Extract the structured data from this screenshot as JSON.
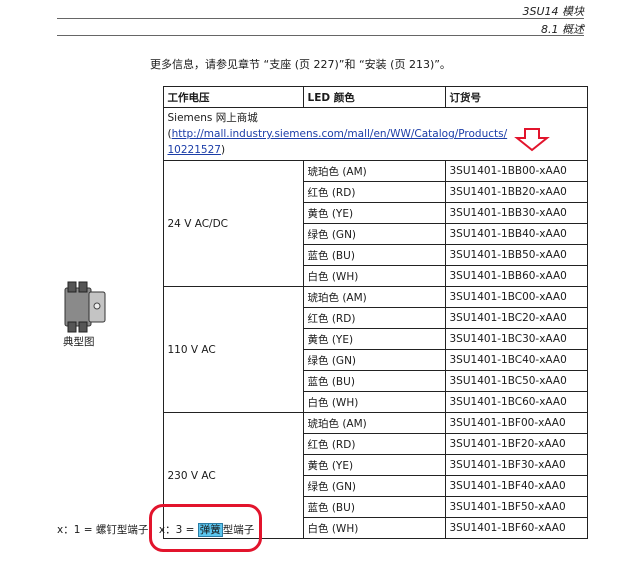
{
  "header": {
    "chapter": "3SU14 模块",
    "section": "8.1 概述"
  },
  "intro": "更多信息，请参见章节 “支座 (页 227)”和 “安装 (页 213)”。",
  "table": {
    "image_caption": "典型图",
    "columns": [
      "工作电压",
      "LED 颜色",
      "订货号"
    ],
    "mall": {
      "prefix": "Siemens 网上商城 (",
      "link_line1": "http://mall.industry.siemens.com/mall/en/WW/Catalog/Products/",
      "link_line2": "10221527",
      "suffix": ")"
    },
    "groups": [
      {
        "voltage": "24 V AC/DC",
        "rows": [
          {
            "color": "琥珀色 (AM)",
            "order": "3SU1401-1BB00-xAA0"
          },
          {
            "color": "红色 (RD)",
            "order": "3SU1401-1BB20-xAA0"
          },
          {
            "color": "黄色 (YE)",
            "order": "3SU1401-1BB30-xAA0"
          },
          {
            "color": "绿色 (GN)",
            "order": "3SU1401-1BB40-xAA0"
          },
          {
            "color": "蓝色 (BU)",
            "order": "3SU1401-1BB50-xAA0"
          },
          {
            "color": "白色 (WH)",
            "order": "3SU1401-1BB60-xAA0"
          }
        ]
      },
      {
        "voltage": "110 V AC",
        "rows": [
          {
            "color": "琥珀色 (AM)",
            "order": "3SU1401-1BC00-xAA0"
          },
          {
            "color": "红色 (RD)",
            "order": "3SU1401-1BC20-xAA0"
          },
          {
            "color": "黄色 (YE)",
            "order": "3SU1401-1BC30-xAA0"
          },
          {
            "color": "绿色 (GN)",
            "order": "3SU1401-1BC40-xAA0"
          },
          {
            "color": "蓝色 (BU)",
            "order": "3SU1401-1BC50-xAA0"
          },
          {
            "color": "白色 (WH)",
            "order": "3SU1401-1BC60-xAA0"
          }
        ]
      },
      {
        "voltage": "230 V AC",
        "rows": [
          {
            "color": "琥珀色 (AM)",
            "order": "3SU1401-1BF00-xAA0"
          },
          {
            "color": "红色 (RD)",
            "order": "3SU1401-1BF20-xAA0"
          },
          {
            "color": "黄色 (YE)",
            "order": "3SU1401-1BF30-xAA0"
          },
          {
            "color": "绿色 (GN)",
            "order": "3SU1401-1BF40-xAA0"
          },
          {
            "color": "蓝色 (BU)",
            "order": "3SU1401-1BF50-xAA0"
          },
          {
            "color": "白色 (WH)",
            "order": "3SU1401-1BF60-xAA0"
          }
        ]
      }
    ]
  },
  "footnote": {
    "part1": "x：1 = 螺钉型端子；x：3 = ",
    "highlight": "弹簧",
    "part2": "型端子"
  },
  "annotation_colors": {
    "arrow": "#e2142c",
    "circle": "#e2142c",
    "highlight": "#5cc6ef"
  }
}
